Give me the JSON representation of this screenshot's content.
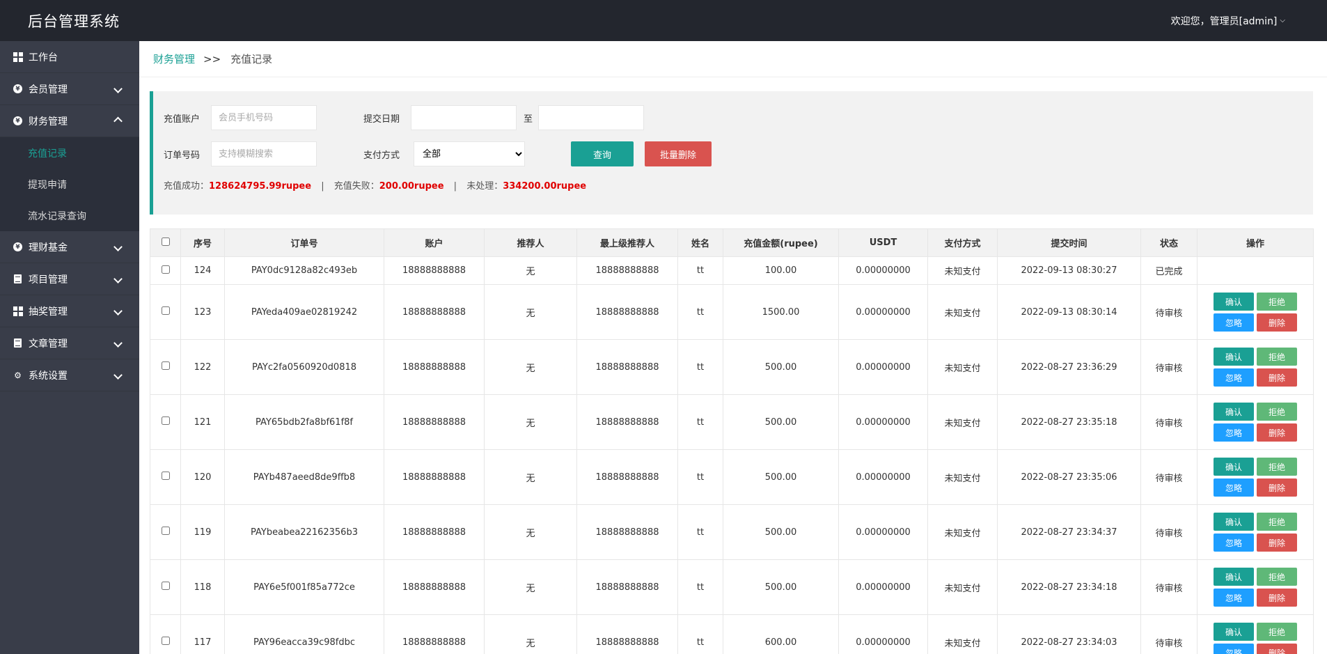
{
  "header": {
    "title": "后台管理系统",
    "user": "欢迎您，管理员[admin]"
  },
  "sidebar": {
    "items": [
      {
        "label": "工作台",
        "icon": "dashboard-icon"
      },
      {
        "label": "会员管理",
        "icon": "member-icon"
      },
      {
        "label": "财务管理",
        "icon": "finance-icon",
        "expanded": true,
        "children": [
          {
            "label": "充值记录",
            "active": true
          },
          {
            "label": "提现申请"
          },
          {
            "label": "流水记录查询"
          }
        ]
      },
      {
        "label": "理财基金",
        "icon": "fund-icon"
      },
      {
        "label": "项目管理",
        "icon": "project-icon"
      },
      {
        "label": "抽奖管理",
        "icon": "lottery-icon"
      },
      {
        "label": "文章管理",
        "icon": "article-icon"
      },
      {
        "label": "系统设置",
        "icon": "gear-icon"
      }
    ]
  },
  "breadcrumb": {
    "parent": "财务管理",
    "separator": ">>",
    "current": "充值记录"
  },
  "filters": {
    "account_label": "充值账户",
    "account_placeholder": "会员手机号码",
    "date_label": "提交日期",
    "date_to": "至",
    "order_label": "订单号码",
    "order_placeholder": "支持模糊搜索",
    "payment_label": "支付方式",
    "payment_selected": "全部",
    "query_button": "查询",
    "batch_delete_button": "批量删除"
  },
  "stats": {
    "success_label": "充值成功：",
    "success_value": "128624795.99rupee",
    "fail_label": "充值失败：",
    "fail_value": "200.00rupee",
    "pending_label": "未处理：",
    "pending_value": "334200.00rupee",
    "separator": "|"
  },
  "table": {
    "headers": [
      "序号",
      "订单号",
      "账户",
      "推荐人",
      "最上级推荐人",
      "姓名",
      "充值金额(rupee)",
      "USDT",
      "支付方式",
      "提交时间",
      "状态",
      "操作"
    ],
    "op_labels": {
      "confirm": "确认",
      "reject": "拒绝",
      "ignore": "忽略",
      "delete": "删除"
    },
    "rows": [
      {
        "id": "124",
        "order": "PAY0dc9128a82c493eb",
        "account": "18888888888",
        "referrer": "无",
        "top_referrer": "18888888888",
        "name": "tt",
        "amount": "100.00",
        "usdt": "0.00000000",
        "payment": "未知支付",
        "time": "2022-09-13 08:30:27",
        "status": "已完成",
        "has_actions": false
      },
      {
        "id": "123",
        "order": "PAYeda409ae02819242",
        "account": "18888888888",
        "referrer": "无",
        "top_referrer": "18888888888",
        "name": "tt",
        "amount": "1500.00",
        "usdt": "0.00000000",
        "payment": "未知支付",
        "time": "2022-09-13 08:30:14",
        "status": "待审核",
        "has_actions": true
      },
      {
        "id": "122",
        "order": "PAYc2fa0560920d0818",
        "account": "18888888888",
        "referrer": "无",
        "top_referrer": "18888888888",
        "name": "tt",
        "amount": "500.00",
        "usdt": "0.00000000",
        "payment": "未知支付",
        "time": "2022-08-27 23:36:29",
        "status": "待审核",
        "has_actions": true
      },
      {
        "id": "121",
        "order": "PAY65bdb2fa8bf61f8f",
        "account": "18888888888",
        "referrer": "无",
        "top_referrer": "18888888888",
        "name": "tt",
        "amount": "500.00",
        "usdt": "0.00000000",
        "payment": "未知支付",
        "time": "2022-08-27 23:35:18",
        "status": "待审核",
        "has_actions": true
      },
      {
        "id": "120",
        "order": "PAYb487aeed8de9ffb8",
        "account": "18888888888",
        "referrer": "无",
        "top_referrer": "18888888888",
        "name": "tt",
        "amount": "500.00",
        "usdt": "0.00000000",
        "payment": "未知支付",
        "time": "2022-08-27 23:35:06",
        "status": "待审核",
        "has_actions": true
      },
      {
        "id": "119",
        "order": "PAYbeabea22162356b3",
        "account": "18888888888",
        "referrer": "无",
        "top_referrer": "18888888888",
        "name": "tt",
        "amount": "500.00",
        "usdt": "0.00000000",
        "payment": "未知支付",
        "time": "2022-08-27 23:34:37",
        "status": "待审核",
        "has_actions": true
      },
      {
        "id": "118",
        "order": "PAY6e5f001f85a772ce",
        "account": "18888888888",
        "referrer": "无",
        "top_referrer": "18888888888",
        "name": "tt",
        "amount": "500.00",
        "usdt": "0.00000000",
        "payment": "未知支付",
        "time": "2022-08-27 23:34:18",
        "status": "待审核",
        "has_actions": true
      },
      {
        "id": "117",
        "order": "PAY96eacca39c98fdbc",
        "account": "18888888888",
        "referrer": "无",
        "top_referrer": "18888888888",
        "name": "tt",
        "amount": "600.00",
        "usdt": "0.00000000",
        "payment": "未知支付",
        "time": "2022-08-27 23:34:03",
        "status": "待审核",
        "has_actions": true
      }
    ]
  }
}
